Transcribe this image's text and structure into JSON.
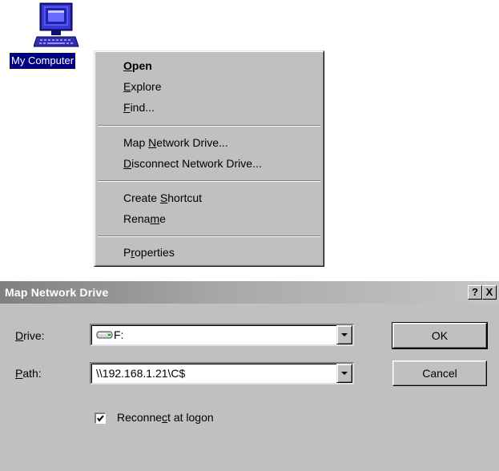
{
  "desktop": {
    "icon_label": "My Computer"
  },
  "context_menu": {
    "items": [
      {
        "pre": "",
        "key": "O",
        "post": "pen",
        "bold": true
      },
      {
        "pre": "",
        "key": "E",
        "post": "xplore"
      },
      {
        "pre": "",
        "key": "F",
        "post": "ind..."
      },
      {
        "pre": "Map ",
        "key": "N",
        "post": "etwork Drive..."
      },
      {
        "pre": "",
        "key": "D",
        "post": "isconnect Network Drive..."
      },
      {
        "pre": "Create ",
        "key": "S",
        "post": "hortcut"
      },
      {
        "pre": "Rena",
        "key": "m",
        "post": "e"
      },
      {
        "pre": "P",
        "key": "r",
        "post": "operties"
      }
    ]
  },
  "dialog": {
    "title": "Map Network Drive",
    "help_glyph": "?",
    "close_glyph": "X",
    "drive_label": {
      "key": "D",
      "rest": "rive:"
    },
    "drive_value": "F:",
    "path_label": {
      "key": "P",
      "rest": "ath:"
    },
    "path_value": "\\\\192.168.1.21\\C$",
    "reconnect": {
      "pre": "Reconne",
      "key": "c",
      "post": "t at logon",
      "checked": true
    },
    "ok_label": "OK",
    "cancel_label": "Cancel"
  },
  "colors": {
    "selection": "#000080",
    "face": "#c0c0c0",
    "titlebar_inactive": "#808080"
  }
}
